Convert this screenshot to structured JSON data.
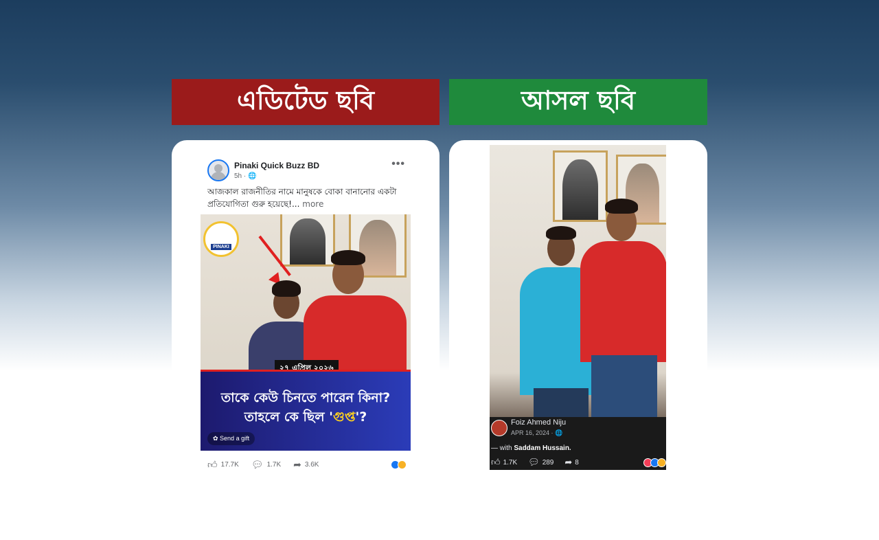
{
  "banners": {
    "edited": "এডিটেড ছবি",
    "original": "আসল ছবি"
  },
  "colors": {
    "edited_banner": "#9b1b1b",
    "original_banner": "#1f8a3c",
    "facebook_blue": "#1877f2",
    "headline_yellow": "#ffd21f"
  },
  "edited_post": {
    "page_name": "Pinaki Quick Buzz BD",
    "time": "5h · 🌐",
    "more_icon": "ellipsis-icon",
    "text": "আজকাল রাজনীতির নামে মানুষকে বোকা বানানোর একটা প্রতিযোগিতা গুরু হয়েছে!...",
    "more_label": "more",
    "logo_text": "PINAKI",
    "date_tag": "২৭ এপ্রিল ২০২৬",
    "headline_line1": "তাকে কেউ চিনতে পারেন কিনা?",
    "headline_line2_prefix": "তাহলে কে ছিল '",
    "headline_line2_highlight": "গুপ্ত",
    "headline_line2_suffix": "'?",
    "gift_label": "Send a gift",
    "likes": "17.7K",
    "comments": "1.7K",
    "shares": "3.6K"
  },
  "original_post": {
    "author": "Foiz Ahmed Niju",
    "date": "APR 16, 2024 · 🌐",
    "with_prefix": "— with",
    "with_name": "Saddam Hussain.",
    "likes": "1.7K",
    "comments": "289",
    "shares": "8"
  }
}
